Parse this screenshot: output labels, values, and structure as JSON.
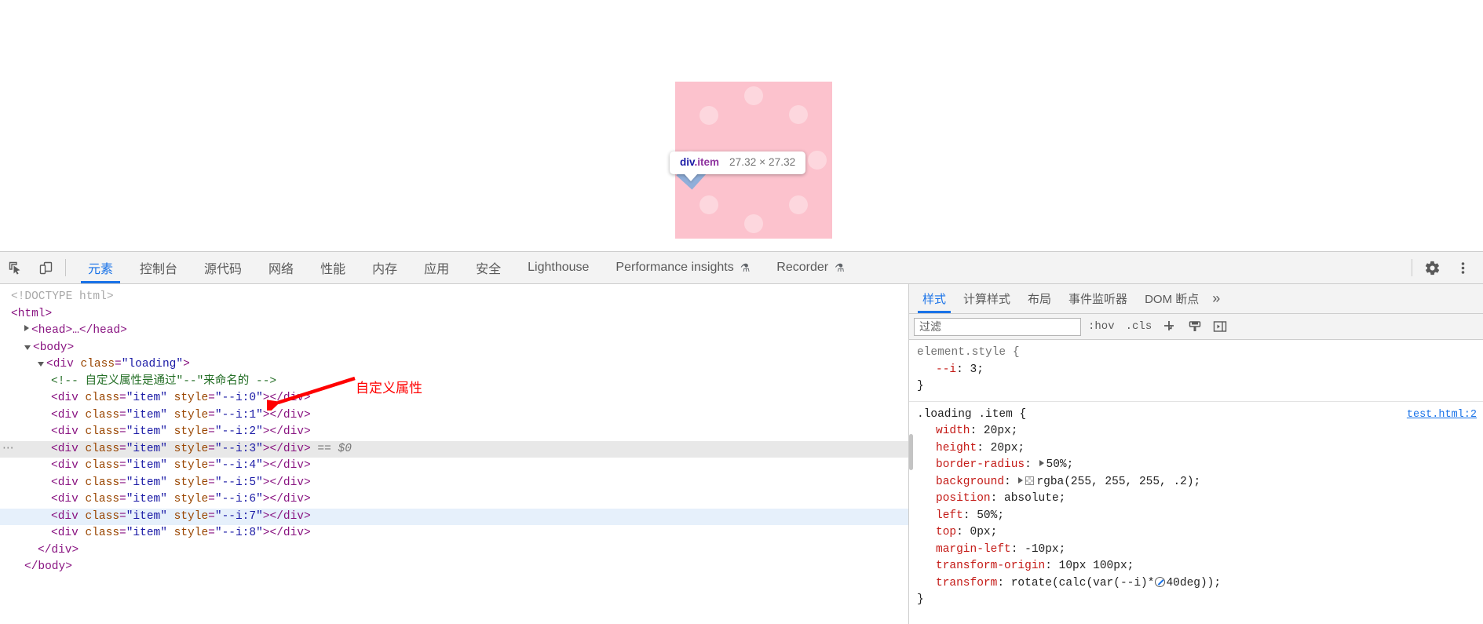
{
  "preview": {
    "loading_box": {
      "bg_color": "#fcc2cd",
      "dot_color": "rgba(255,255,255,0.35)",
      "dot_count": 9
    },
    "highlight_tooltip": {
      "tag": "div",
      "class": ".item",
      "dimensions": "27.32 × 27.32"
    }
  },
  "devtools": {
    "toolbar": {
      "inspect_icon": "inspect-cursor-icon",
      "device_icon": "device-toolbar-icon",
      "settings_icon": "gear-icon",
      "more_icon": "more-vertical-icon",
      "tabs": [
        {
          "label": "元素",
          "active": true,
          "experimental": false
        },
        {
          "label": "控制台",
          "active": false,
          "experimental": false
        },
        {
          "label": "源代码",
          "active": false,
          "experimental": false
        },
        {
          "label": "网络",
          "active": false,
          "experimental": false
        },
        {
          "label": "性能",
          "active": false,
          "experimental": false
        },
        {
          "label": "内存",
          "active": false,
          "experimental": false
        },
        {
          "label": "应用",
          "active": false,
          "experimental": false
        },
        {
          "label": "安全",
          "active": false,
          "experimental": false
        },
        {
          "label": "Lighthouse",
          "active": false,
          "experimental": false
        },
        {
          "label": "Performance insights",
          "active": false,
          "experimental": true
        },
        {
          "label": "Recorder",
          "active": false,
          "experimental": true
        }
      ],
      "flask_glyph": "⚗"
    },
    "dom_tree": {
      "annotation": {
        "text": "自定义属性",
        "color": "#ff0000"
      },
      "rows": [
        {
          "indent": 0,
          "twisty": "none",
          "kind": "doctype",
          "text": "<!DOCTYPE html>",
          "state": "normal"
        },
        {
          "indent": 0,
          "twisty": "none",
          "kind": "tag",
          "text": "<html>",
          "state": "normal"
        },
        {
          "indent": 1,
          "twisty": "closed",
          "kind": "tag-collapsed",
          "text": "<head>…</head>",
          "state": "normal"
        },
        {
          "indent": 1,
          "twisty": "open",
          "kind": "tag",
          "text": "<body>",
          "state": "normal"
        },
        {
          "indent": 2,
          "twisty": "open",
          "kind": "tag-class",
          "tag": "div",
          "attr": "class",
          "value": "loading",
          "state": "normal"
        },
        {
          "indent": 3,
          "twisty": "none",
          "kind": "comment",
          "text": "<!-- 自定义属性是通过\"--\"来命名的 -->",
          "state": "normal"
        },
        {
          "indent": 3,
          "twisty": "none",
          "kind": "item",
          "class_value": "item",
          "style_value": "--i:0",
          "state": "normal"
        },
        {
          "indent": 3,
          "twisty": "none",
          "kind": "item",
          "class_value": "item",
          "style_value": "--i:1",
          "state": "normal"
        },
        {
          "indent": 3,
          "twisty": "none",
          "kind": "item",
          "class_value": "item",
          "style_value": "--i:2",
          "state": "normal"
        },
        {
          "indent": 3,
          "twisty": "none",
          "kind": "item",
          "class_value": "item",
          "style_value": "--i:3",
          "state": "selected",
          "suffix": "== $0"
        },
        {
          "indent": 3,
          "twisty": "none",
          "kind": "item",
          "class_value": "item",
          "style_value": "--i:4",
          "state": "normal"
        },
        {
          "indent": 3,
          "twisty": "none",
          "kind": "item",
          "class_value": "item",
          "style_value": "--i:5",
          "state": "normal"
        },
        {
          "indent": 3,
          "twisty": "none",
          "kind": "item",
          "class_value": "item",
          "style_value": "--i:6",
          "state": "normal"
        },
        {
          "indent": 3,
          "twisty": "none",
          "kind": "item",
          "class_value": "item",
          "style_value": "--i:7",
          "state": "hovered"
        },
        {
          "indent": 3,
          "twisty": "none",
          "kind": "item",
          "class_value": "item",
          "style_value": "--i:8",
          "state": "normal"
        },
        {
          "indent": 2,
          "twisty": "none",
          "kind": "tag",
          "text": "</div>",
          "state": "normal"
        },
        {
          "indent": 1,
          "twisty": "none",
          "kind": "tag",
          "text": "</body>",
          "state": "normal"
        }
      ]
    },
    "styles_panel": {
      "tabs": [
        {
          "label": "样式",
          "active": true
        },
        {
          "label": "计算样式",
          "active": false
        },
        {
          "label": "布局",
          "active": false
        },
        {
          "label": "事件监听器",
          "active": false
        },
        {
          "label": "DOM 断点",
          "active": false
        }
      ],
      "more_glyph": "»",
      "filter_placeholder": "过滤",
      "filter_value": "",
      "hov_label": ":hov",
      "cls_label": ".cls",
      "plus_label": "+",
      "new_style_rule_icon": "new-style-rule-icon",
      "toggle_sidebar_icon": "toggle-sidebar-icon",
      "rules": [
        {
          "selector": "element.style {",
          "origin": "",
          "close": "}",
          "declarations": [
            {
              "property": "--i",
              "value": "3",
              "swatch": false,
              "expand": false,
              "angle": false
            }
          ]
        },
        {
          "selector": ".loading .item {",
          "origin": "test.html:2",
          "close": "}",
          "declarations": [
            {
              "property": "width",
              "value": "20px",
              "swatch": false,
              "expand": false,
              "angle": false
            },
            {
              "property": "height",
              "value": "20px",
              "swatch": false,
              "expand": false,
              "angle": false
            },
            {
              "property": "border-radius",
              "value": "50%",
              "swatch": false,
              "expand": true,
              "angle": false
            },
            {
              "property": "background",
              "value": "rgba(255, 255, 255, .2)",
              "swatch": true,
              "expand": true,
              "angle": false
            },
            {
              "property": "position",
              "value": "absolute",
              "swatch": false,
              "expand": false,
              "angle": false
            },
            {
              "property": "left",
              "value": "50%",
              "swatch": false,
              "expand": false,
              "angle": false
            },
            {
              "property": "top",
              "value": "0px",
              "swatch": false,
              "expand": false,
              "angle": false
            },
            {
              "property": "margin-left",
              "value": "-10px",
              "swatch": false,
              "expand": false,
              "angle": false
            },
            {
              "property": "transform-origin",
              "value": "10px 100px",
              "swatch": false,
              "expand": false,
              "angle": false
            },
            {
              "property": "transform",
              "value": "rotate(calc(var(--i)*40deg));",
              "swatch": false,
              "expand": false,
              "angle": true
            }
          ]
        }
      ]
    }
  }
}
